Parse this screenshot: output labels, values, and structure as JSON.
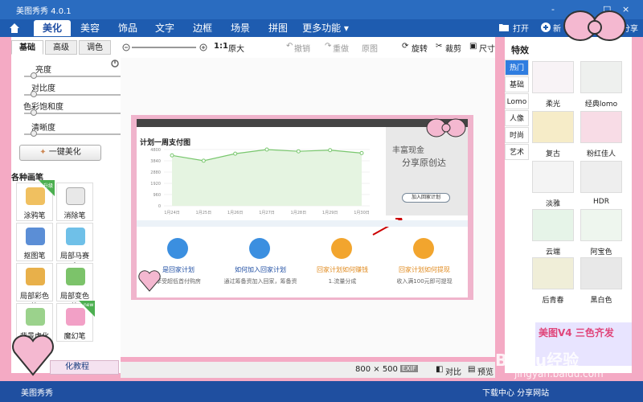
{
  "titlebar": {
    "app_title": "美图秀秀 4.0.1",
    "minimize": "-",
    "maximize": "□",
    "close": "×"
  },
  "tabs": [
    "美化",
    "美容",
    "饰品",
    "文字",
    "边框",
    "场景",
    "拼图",
    "更多功能"
  ],
  "topright": {
    "open_label": "打开",
    "new_label": "新",
    "share_label": "享与分享"
  },
  "left": {
    "subtabs": [
      "基础",
      "高级",
      "调色"
    ],
    "sliders": [
      "亮度",
      "对比度",
      "色彩饱和度",
      "清晰度"
    ],
    "onekey_label": "一键美化",
    "brush_header": "各种画笔",
    "brushes": [
      "涂鸦笔",
      "消除笔",
      "抠图笔",
      "局部马赛克",
      "局部彩色笔",
      "局部变色笔",
      "背景虚化",
      "魔幻笔"
    ],
    "badge_upgrade": "升级",
    "badge_new": "new",
    "tutorial_label": "化教程"
  },
  "toolbar": {
    "ratio": "1:1",
    "original": "原大",
    "undo": "撤销",
    "redo": "重做",
    "orig": "原图",
    "rotate": "旋转",
    "crop": "裁剪",
    "size": "尺寸"
  },
  "photo": {
    "chart_title": "计划一周支付图",
    "ad_title": "丰富现金",
    "ad_sub": "分享原创达",
    "ad_btn": "加入回家计划",
    "cards": [
      {
        "label": "是回家计划",
        "sub": "享受超低首付购房"
      },
      {
        "label": "如何加入回家计划",
        "sub": "通过筹备资加入回家，筹备资"
      },
      {
        "label": "回家计划如何赚钱",
        "sub": "1.流量分成"
      },
      {
        "label": "回家计划如何提现",
        "sub": "收入满100元即可提现"
      }
    ]
  },
  "chart_data": {
    "type": "line",
    "x": [
      "1月24日",
      "1月25日",
      "1月26日",
      "1月27日",
      "1月28日",
      "1月29日",
      "1月30日"
    ],
    "series": [
      {
        "values": [
          4300,
          3850,
          4450,
          4800,
          4650,
          4750,
          4500
        ]
      }
    ],
    "yticks": [
      "4800",
      "3840",
      "2880",
      "1920",
      "960",
      "0"
    ],
    "ylim": [
      0,
      4800
    ],
    "color": "#79c76e"
  },
  "statusbar": {
    "dims": "800 × 500",
    "exif": "EXIF",
    "compare": "对比",
    "preview": "预览"
  },
  "right": {
    "header": "特效",
    "cats": [
      "热门",
      "基础",
      "Lomo",
      "人像",
      "时尚",
      "艺术"
    ],
    "effects": [
      "柔光",
      "经典lomo",
      "复古",
      "粉红佳人",
      "淡雅",
      "HDR",
      "云端",
      "阿宝色",
      "后青春",
      "黑白色"
    ],
    "ad_text": "美图V4 三色齐发"
  },
  "taskbar": {
    "left_text": "美图秀秀",
    "right_text": "下载中心  分享网站"
  },
  "watermark": {
    "line1": "Baidu经验",
    "line2": "jingyan.baidu.com"
  }
}
